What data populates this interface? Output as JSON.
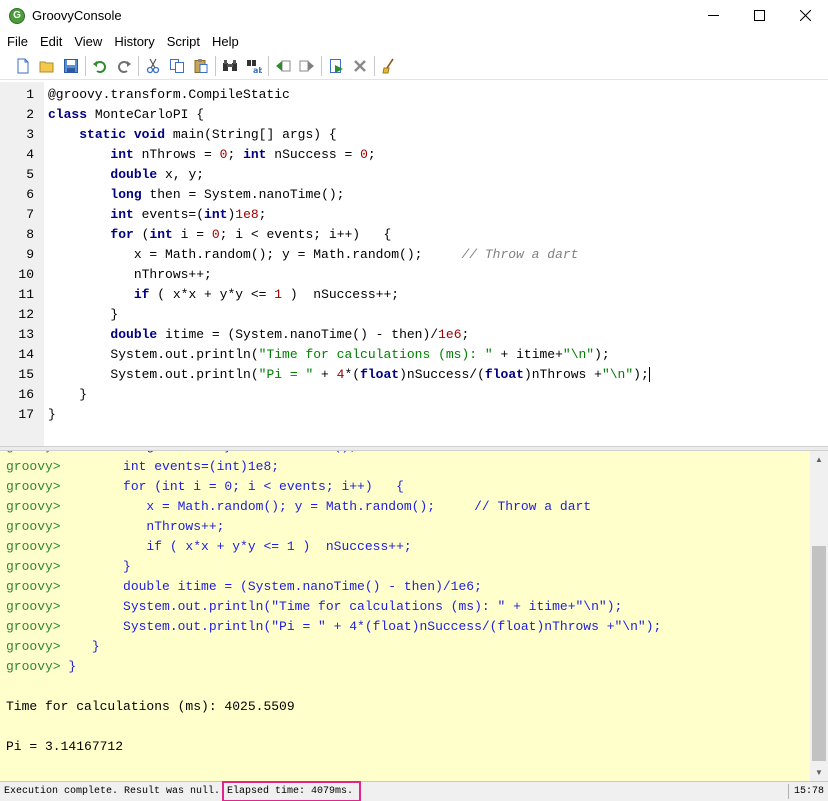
{
  "window": {
    "title": "GroovyConsole",
    "app_icon_letter": "G"
  },
  "menu": [
    "File",
    "Edit",
    "View",
    "History",
    "Script",
    "Help"
  ],
  "toolbar": [
    {
      "name": "new-file-icon",
      "color": "#3a6fc4"
    },
    {
      "name": "open-folder-icon",
      "color": "#d9a42b"
    },
    {
      "name": "save-icon",
      "color": "#3a6fc4"
    },
    {
      "name": "undo-icon",
      "color": "#2e8b2e"
    },
    {
      "name": "redo-icon",
      "color": "#606060"
    },
    {
      "name": "cut-icon",
      "color": "#3a6fc4"
    },
    {
      "name": "copy-icon",
      "color": "#3a6fc4"
    },
    {
      "name": "paste-icon",
      "color": "#b08a3a"
    },
    {
      "name": "find-icon",
      "color": "#333333"
    },
    {
      "name": "replace-icon",
      "color": "#3a6fc4"
    },
    {
      "name": "history-previous-icon",
      "color": "#2e8b2e"
    },
    {
      "name": "history-next-icon",
      "color": "#606060"
    },
    {
      "name": "run-script-icon",
      "color": "#2e8b2e"
    },
    {
      "name": "interrupt-icon",
      "color": "#808080"
    },
    {
      "name": "clear-output-icon",
      "color": "#d9a42b"
    }
  ],
  "editor": {
    "lines": [
      {
        "n": "1",
        "html": "@groovy.transform.CompileStatic"
      },
      {
        "n": "2",
        "html": "<span class=\"kw\">class</span> MonteCarloPI {"
      },
      {
        "n": "3",
        "html": "    <span class=\"kw\">static</span> <span class=\"kw\">void</span> main(String[] args) {"
      },
      {
        "n": "4",
        "html": "        <span class=\"kw\">int</span> nThrows = <span class=\"num\">0</span>; <span class=\"kw\">int</span> nSuccess = <span class=\"num\">0</span>;"
      },
      {
        "n": "5",
        "html": "        <span class=\"kw\">double</span> x, y;"
      },
      {
        "n": "6",
        "html": "        <span class=\"kw\">long</span> then = System.nanoTime();"
      },
      {
        "n": "7",
        "html": "        <span class=\"kw\">int</span> events=(<span class=\"kw\">int</span>)<span class=\"num\">1e8</span>;"
      },
      {
        "n": "8",
        "html": "        <span class=\"kw\">for</span> (<span class=\"kw\">int</span> i = <span class=\"num\">0</span>; i &lt; events; i++)   {"
      },
      {
        "n": "9",
        "html": "           x = Math.random(); y = Math.random();     <span class=\"cmt\">// Throw a dart</span>"
      },
      {
        "n": "10",
        "html": "           nThrows++;"
      },
      {
        "n": "11",
        "html": "           <span class=\"kw\">if</span> ( x*x + y*y &lt;= <span class=\"num\">1</span> )  nSuccess++;"
      },
      {
        "n": "12",
        "html": "        }"
      },
      {
        "n": "13",
        "html": "        <span class=\"kw\">double</span> itime = (System.nanoTime() - then)/<span class=\"num\">1e6</span>;"
      },
      {
        "n": "14",
        "html": "        System.out.println(<span class=\"str\">\"Time for calculations (ms): \"</span> + itime+<span class=\"str\">\"\\n\"</span>);"
      },
      {
        "n": "15",
        "html": "        System.out.println(<span class=\"str\">\"Pi = \"</span> + <span class=\"num\">4</span>*(<span class=\"kw\">float</span>)nSuccess/(<span class=\"kw\">float</span>)nThrows +<span class=\"str\">\"\\n\"</span>);<span class=\"caret\"></span>"
      },
      {
        "n": "16",
        "html": "    }"
      },
      {
        "n": "17",
        "html": "}"
      }
    ]
  },
  "output": {
    "lines": [
      {
        "prompt": "groovy>",
        "code": "        long then = System.nanoTime();"
      },
      {
        "prompt": "groovy>",
        "code": "        int events=(int)1e8;"
      },
      {
        "prompt": "groovy>",
        "code": "        for (int i = 0; i < events; i++)   {"
      },
      {
        "prompt": "groovy>",
        "code": "           x = Math.random(); y = Math.random();     // Throw a dart"
      },
      {
        "prompt": "groovy>",
        "code": "           nThrows++;"
      },
      {
        "prompt": "groovy>",
        "code": "           if ( x*x + y*y <= 1 )  nSuccess++;"
      },
      {
        "prompt": "groovy>",
        "code": "        }"
      },
      {
        "prompt": "groovy>",
        "code": "        double itime = (System.nanoTime() - then)/1e6;"
      },
      {
        "prompt": "groovy>",
        "code": "        System.out.println(\"Time for calculations (ms): \" + itime+\"\\n\");"
      },
      {
        "prompt": "groovy>",
        "code": "        System.out.println(\"Pi = \" + 4*(float)nSuccess/(float)nThrows +\"\\n\");"
      },
      {
        "prompt": "groovy>",
        "code": "    }"
      },
      {
        "prompt": "groovy>",
        "code": " }"
      },
      {
        "prompt": "",
        "code": ""
      },
      {
        "prompt": "",
        "code": "Time for calculations (ms): 4025.5509",
        "result": true
      },
      {
        "prompt": "",
        "code": ""
      },
      {
        "prompt": "",
        "code": "Pi = 3.14167712",
        "result": true
      }
    ]
  },
  "status": {
    "message": "Execution complete. Result was null.",
    "elapsed": "Elapsed time: 4079ms.",
    "position": "15:78",
    "highlight_color": "#e0258c"
  }
}
